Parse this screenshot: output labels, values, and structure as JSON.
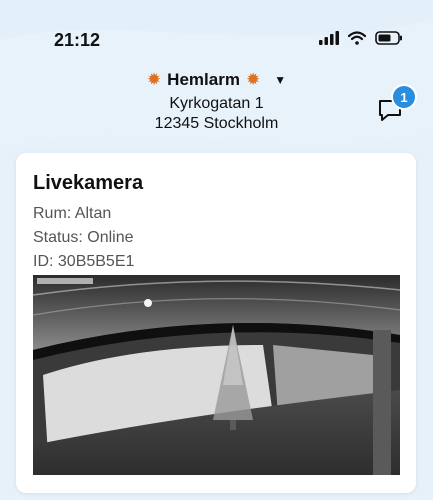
{
  "status_bar": {
    "time": "21:12"
  },
  "header": {
    "brand": "Hemlarm",
    "address_line1": "Kyrkogatan 1",
    "address_line2": "12345 Stockholm",
    "notification_count": "1"
  },
  "card": {
    "title": "Livekamera",
    "room": "Rum: Altan",
    "status": "Status: Online",
    "id": "ID: 30B5B5E1"
  },
  "colors": {
    "background": "#e6f1fa",
    "badge": "#2a8ee0",
    "accent_spark": "#e07020"
  }
}
